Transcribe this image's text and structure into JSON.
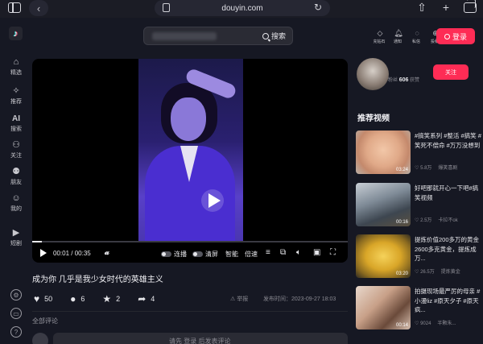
{
  "browser": {
    "url": "douyin.com"
  },
  "nav": {
    "items": [
      {
        "label": "精选",
        "icon": "home-icon"
      },
      {
        "label": "推荐",
        "icon": "sparkle-icon"
      },
      {
        "label": "搜索",
        "icon": "ai-icon",
        "icon_text": "AI"
      },
      {
        "label": "关注",
        "icon": "person-add-icon"
      },
      {
        "label": "朋友",
        "icon": "friends-icon"
      },
      {
        "label": "我的",
        "icon": "profile-icon"
      },
      {
        "label": "短剧",
        "icon": "drama-icon"
      }
    ]
  },
  "search": {
    "button_label": "搜索"
  },
  "header": {
    "actions": [
      {
        "label": "充钻石",
        "icon": "diamond-icon"
      },
      {
        "label": "通知",
        "icon": "bell-icon"
      },
      {
        "label": "私信",
        "icon": "message-icon"
      },
      {
        "label": "投稿",
        "icon": "upload-icon"
      }
    ],
    "login_label": "登录"
  },
  "player": {
    "current_time": "00:01",
    "duration": "00:35",
    "progress": 0.03,
    "logo_text": "𝓪",
    "autoplay_label": "连播",
    "clear_screen_label": "清屏",
    "smart_label": "智能",
    "speed_label": "倍速"
  },
  "video": {
    "title": "成为你 几乎是我少女时代的英雄主义",
    "likes": "50",
    "comments": "6",
    "favorites": "2",
    "shares": "4",
    "report_label": "举报",
    "publish_time": "发布时间：2023-09-27 18:03"
  },
  "comments": {
    "header": "全部评论",
    "input_prompt": "请先 登录 后发表评论"
  },
  "author": {
    "fans_label": "粉丝",
    "fans_count": "606",
    "likes_label": "获赞",
    "follow_label": "关注"
  },
  "recommended": {
    "heading": "推荐视频",
    "items": [
      {
        "title": "#搞笑系列 #整活 #搞笑 #笑死不偿命 #万万没想到",
        "duration": "03:24",
        "likes": "5.8万",
        "author": "爆笑喜剧"
      },
      {
        "title": "好吧那就开心一下吧#搞笑视频",
        "duration": "00:16",
        "likes": "2.5万",
        "author": "卡拉不ok"
      },
      {
        "title": "提炼价值200多万的黄金 2600多克黄金，提炼成万...",
        "duration": "03:20",
        "likes": "26.5万",
        "author": "提炼黄金"
      },
      {
        "title": "拍摄现场最严厉的母亲 #小漫liz #原天夕子 #原天疯...",
        "duration": "00:14",
        "likes": "9024",
        "author": "半颗朱..."
      }
    ]
  },
  "colors": {
    "background": "#161823",
    "accent": "#fe2c55"
  }
}
